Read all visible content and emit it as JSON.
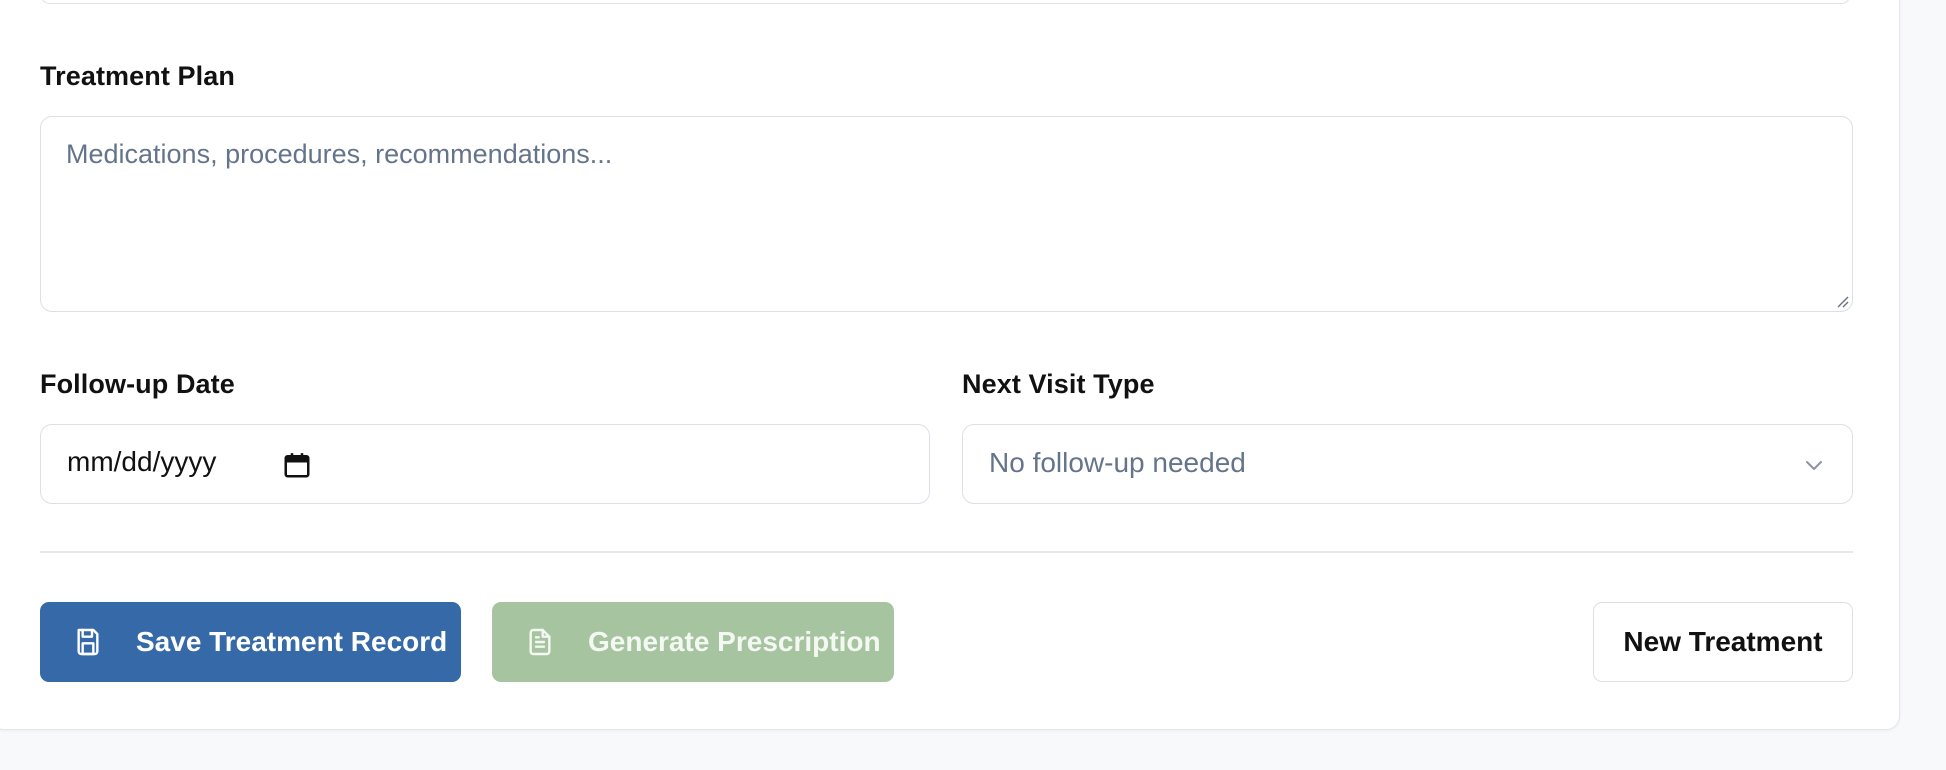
{
  "treatment_plan": {
    "label": "Treatment Plan",
    "placeholder": "Medications, procedures, recommendations...",
    "value": ""
  },
  "follow_up_date": {
    "label": "Follow-up Date",
    "value": "mm/dd/yyyy"
  },
  "next_visit_type": {
    "label": "Next Visit Type",
    "selected": "No follow-up needed"
  },
  "actions": {
    "save_label": "Save Treatment Record",
    "generate_label": "Generate Prescription",
    "new_label": "New Treatment"
  },
  "colors": {
    "primary": "#3669a8",
    "disabled_green": "#a6c49f",
    "placeholder_text": "#64748b",
    "border": "#dcdfe6",
    "page_background": "#f8f9fb"
  },
  "icons": {
    "save": "save-icon",
    "prescription": "file-text-icon",
    "calendar": "calendar-icon",
    "dropdown": "chevron-down-icon"
  }
}
